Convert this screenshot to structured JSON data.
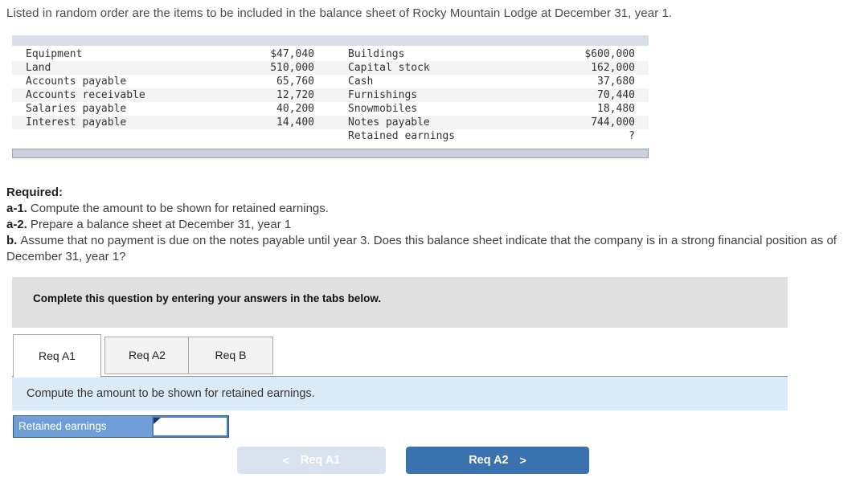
{
  "page": {
    "title": "Listed in random order are the items to be included in the balance sheet of Rocky Mountain Lodge at December 31, year 1."
  },
  "items_table": {
    "rows": [
      {
        "l_label": "Equipment",
        "l_value": "$47,040",
        "r_label": "Buildings",
        "r_value": "$600,000"
      },
      {
        "l_label": "Land",
        "l_value": "510,000",
        "r_label": "Capital stock",
        "r_value": "162,000"
      },
      {
        "l_label": "Accounts payable",
        "l_value": "65,760",
        "r_label": "Cash",
        "r_value": "37,680"
      },
      {
        "l_label": "Accounts receivable",
        "l_value": "12,720",
        "r_label": "Furnishings",
        "r_value": "70,440"
      },
      {
        "l_label": "Salaries payable",
        "l_value": "40,200",
        "r_label": "Snowmobiles",
        "r_value": "18,480"
      },
      {
        "l_label": "Interest payable",
        "l_value": "14,400",
        "r_label": "Notes payable",
        "r_value": "744,000"
      },
      {
        "l_label": "",
        "l_value": "",
        "r_label": "Retained earnings",
        "r_value": "?"
      }
    ]
  },
  "required": {
    "heading": "Required:",
    "items": [
      {
        "prefix": "a-1.",
        "text": "Compute the amount to be shown for retained earnings."
      },
      {
        "prefix": "a-2.",
        "text": "Prepare a balance sheet at December 31, year 1"
      },
      {
        "prefix": "b.",
        "text": "Assume that no payment is due on the notes payable until year 3. Does this balance sheet indicate that the company is in a strong financial position as of December 31, year 1?"
      }
    ]
  },
  "instruction_banner": {
    "text": "Complete this question by entering your answers in the tabs below."
  },
  "tabs": [
    {
      "label": "Req A1",
      "active": true
    },
    {
      "label": "Req A2",
      "active": false
    },
    {
      "label": "Req B",
      "active": false
    }
  ],
  "tab_panel": {
    "prompt": "Compute the amount to be shown for retained earnings."
  },
  "answer_row": {
    "label": "Retained earnings",
    "input_value": "",
    "input_placeholder": ""
  },
  "nav_buttons": {
    "prev": {
      "arrow": "<",
      "label": "Req A1"
    },
    "next": {
      "label": "Req A2",
      "arrow": ">"
    }
  },
  "colors": {
    "accent_blue": "#3a72b0",
    "disabled_button_blue": "#d9e2ef",
    "panel_light_blue": "#d9eaf8",
    "answer_label_blue": "#6f9fd8",
    "banner_gray": "#e0e0e0",
    "table_header_band": "#d7dee8",
    "table_stripe": "#f3f3f3"
  }
}
